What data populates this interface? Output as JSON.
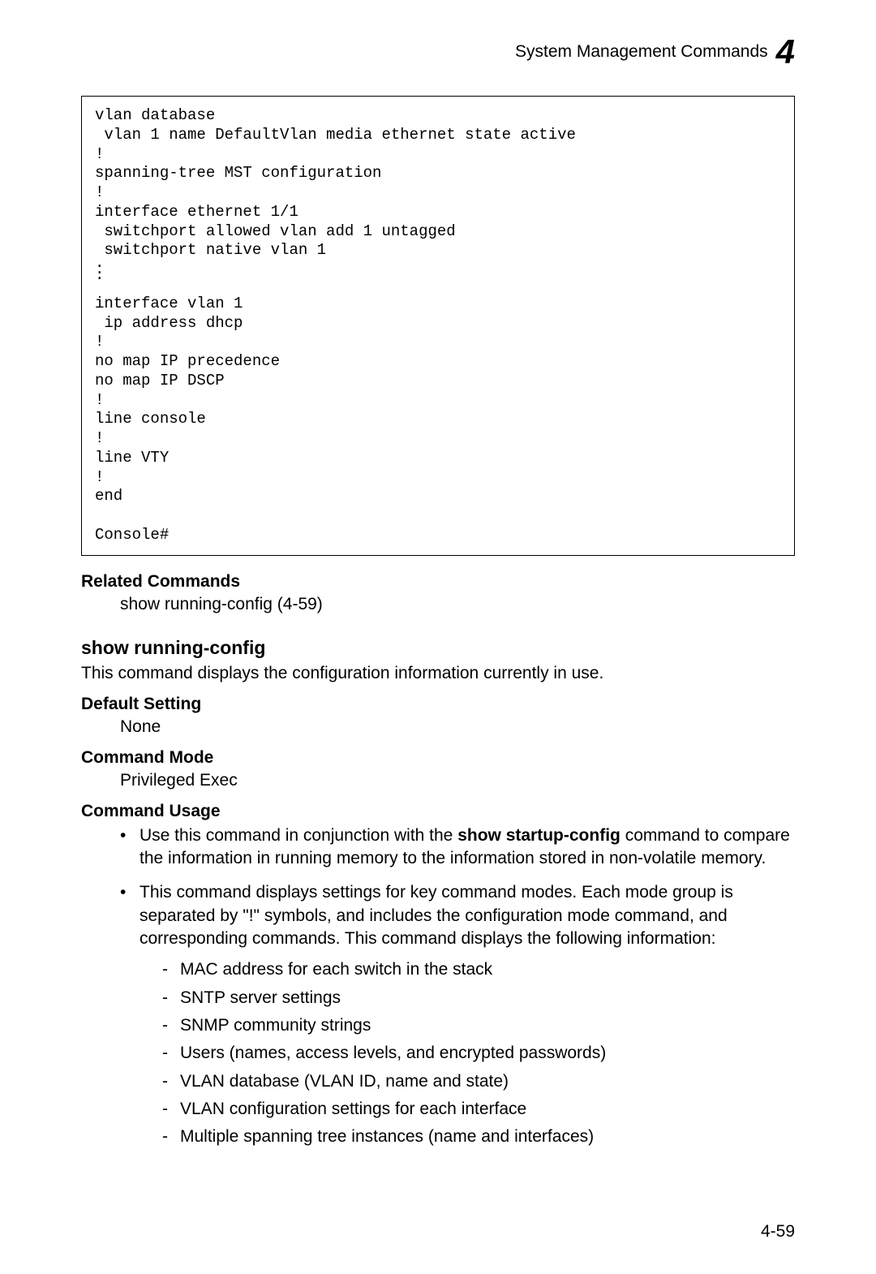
{
  "header": {
    "title": "System Management Commands",
    "chapter": "4"
  },
  "code": {
    "l01": "vlan database",
    "l02": " vlan 1 name DefaultVlan media ethernet state active",
    "l03": "!",
    "l04": "spanning-tree MST configuration",
    "l05": "!",
    "l06": "interface ethernet 1/1",
    "l07": " switchport allowed vlan add 1 untagged",
    "l08": " switchport native vlan 1",
    "l09": "interface vlan 1",
    "l10": " ip address dhcp",
    "l11": "!",
    "l12": "no map IP precedence",
    "l13": "no map IP DSCP",
    "l14": "!",
    "l15": "line console",
    "l16": "!",
    "l17": "line VTY",
    "l18": "!",
    "l19": "end",
    "l20": "",
    "l21": "Console#"
  },
  "related": {
    "heading": "Related Commands",
    "item": "show running-config (4-59)"
  },
  "cmd": {
    "title": "show running-config",
    "desc": "This command displays the configuration information currently in use."
  },
  "default_setting": {
    "heading": "Default Setting",
    "text": "None"
  },
  "command_mode": {
    "heading": "Command Mode",
    "text": "Privileged Exec"
  },
  "command_usage": {
    "heading": "Command Usage",
    "items": {
      "0": {
        "pre": "Use this command in conjunction with the ",
        "bold": "show startup-config",
        "post": " command to compare the information in running memory to the information stored in non-volatile memory."
      },
      "1": {
        "text": "This command displays settings for key command modes. Each mode group is separated by \"!\" symbols, and includes the configuration mode command, and corresponding commands. This command displays the following information:",
        "sub": {
          "0": "MAC address for each switch in the stack",
          "1": "SNTP server settings",
          "2": "SNMP community strings",
          "3": "Users (names, access levels, and encrypted passwords)",
          "4": "VLAN database (VLAN ID, name and state)",
          "5": "VLAN configuration settings for each interface",
          "6": "Multiple spanning tree instances (name and interfaces)"
        }
      }
    }
  },
  "page_number": "4-59"
}
